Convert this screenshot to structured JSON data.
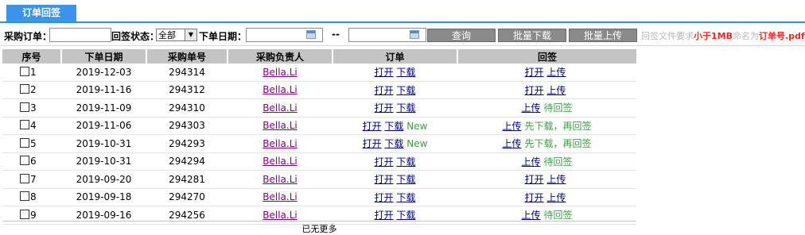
{
  "tab": {
    "label": "订单回签"
  },
  "filter": {
    "order_label": "采购订单：",
    "order_value": "",
    "sign_status_label": "回签状态：",
    "sign_status_value": "全部",
    "date_label": "下单日期：",
    "date_from": "",
    "date_sep": "--",
    "date_to": "",
    "query_button": "查询",
    "batch_download_button": "批量下载",
    "batch_upload_button": "批量上传",
    "hint_prefix": "回签文件要求",
    "hint_size": "小于1MB",
    "hint_mid": "命名为",
    "hint_name": "订单号.pdf"
  },
  "table": {
    "headers": [
      "序号",
      "下单日期",
      "采购单号",
      "采购负责人",
      "订单",
      "回签"
    ],
    "rows": [
      {
        "idx": "1",
        "date": "2019-12-03",
        "po": "294314",
        "owner": "Bella.Li",
        "o1": "打开",
        "o2": "下载",
        "o3": "",
        "s1": "打开",
        "s2": "上传",
        "s3": ""
      },
      {
        "idx": "2",
        "date": "2019-11-16",
        "po": "294312",
        "owner": "Bella.Li",
        "o1": "打开",
        "o2": "下载",
        "o3": "",
        "s1": "打开",
        "s2": "上传",
        "s3": ""
      },
      {
        "idx": "3",
        "date": "2019-11-09",
        "po": "294310",
        "owner": "Bella.Li",
        "o1": "打开",
        "o2": "下载",
        "o3": "",
        "s1": "",
        "s2": "上传",
        "s3": "待回签"
      },
      {
        "idx": "4",
        "date": "2019-11-06",
        "po": "294303",
        "owner": "Bella.Li",
        "o1": "打开",
        "o2": "下载",
        "o3": "New",
        "s1": "",
        "s2": "上传",
        "s3": "先下载，再回签"
      },
      {
        "idx": "5",
        "date": "2019-10-31",
        "po": "294293",
        "owner": "Bella.Li",
        "o1": "打开",
        "o2": "下载",
        "o3": "New",
        "s1": "",
        "s2": "上传",
        "s3": "先下载，再回签"
      },
      {
        "idx": "6",
        "date": "2019-10-31",
        "po": "294294",
        "owner": "Bella.Li",
        "o1": "打开",
        "o2": "下载",
        "o3": "",
        "s1": "",
        "s2": "上传",
        "s3": "待回签"
      },
      {
        "idx": "7",
        "date": "2019-09-20",
        "po": "294281",
        "owner": "Bella.Li",
        "o1": "打开",
        "o2": "下载",
        "o3": "",
        "s1": "打开",
        "s2": "上传",
        "s3": ""
      },
      {
        "idx": "8",
        "date": "2019-09-18",
        "po": "294270",
        "owner": "Bella.Li",
        "o1": "打开",
        "o2": "下载",
        "o3": "",
        "s1": "打开",
        "s2": "上传",
        "s3": ""
      },
      {
        "idx": "9",
        "date": "2019-09-16",
        "po": "294256",
        "owner": "Bella.Li",
        "o1": "打开",
        "o2": "下载",
        "o3": "",
        "s1": "",
        "s2": "上传",
        "s3": "待回签"
      }
    ]
  },
  "footer": "已无更多"
}
